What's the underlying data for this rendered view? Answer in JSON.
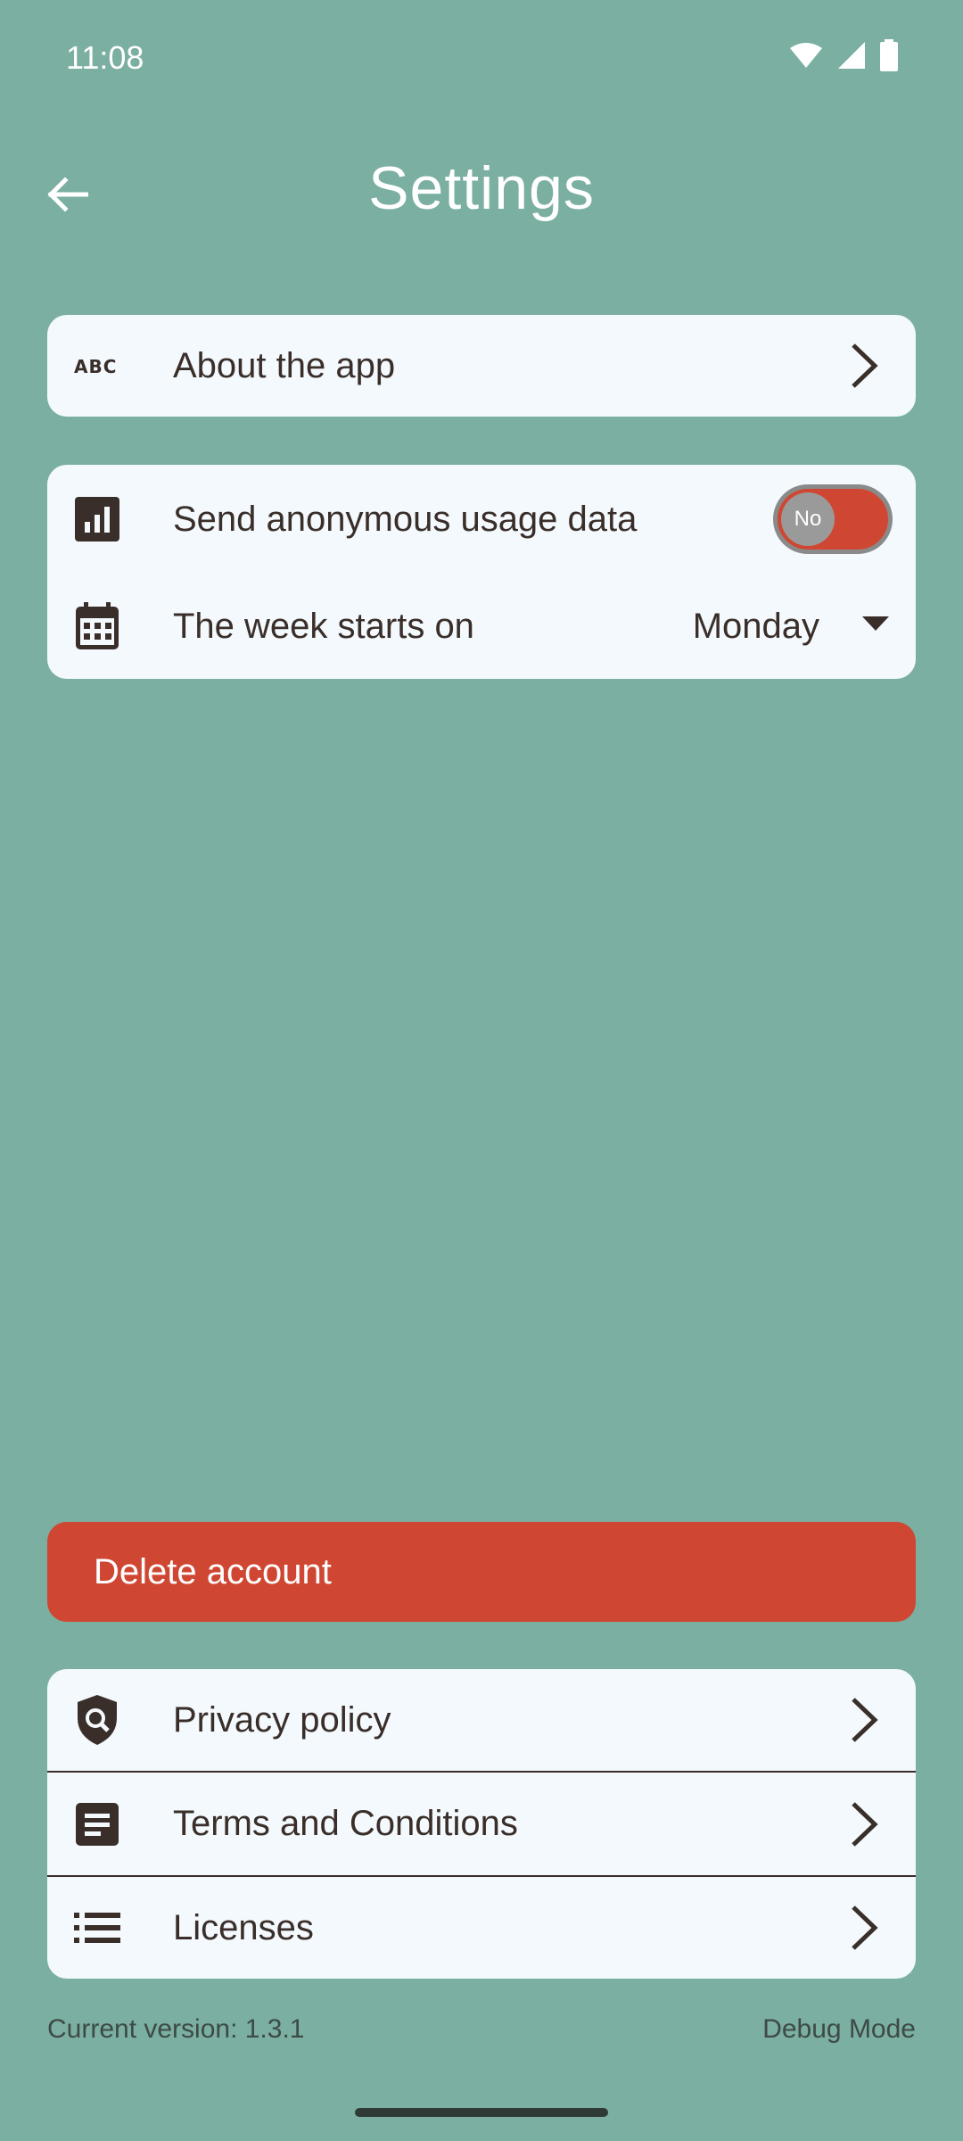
{
  "status_bar": {
    "time": "11:08"
  },
  "app_bar": {
    "title": "Settings",
    "back_icon": "arrow-left-icon"
  },
  "about_card": {
    "label": "About the app",
    "icon": "abc-icon"
  },
  "preferences": {
    "usage": {
      "label": "Send anonymous usage data",
      "icon": "bar-chart-icon",
      "toggle_value": "No",
      "toggle_on": false
    },
    "week_start": {
      "label": "The week starts on",
      "icon": "calendar-icon",
      "selected": "Monday"
    }
  },
  "delete_account": {
    "label": "Delete account",
    "color": "#CF4733"
  },
  "legal": {
    "items": [
      {
        "label": "Privacy policy",
        "icon": "shield-search-icon"
      },
      {
        "label": "Terms and Conditions",
        "icon": "document-icon"
      },
      {
        "label": "Licenses",
        "icon": "list-icon"
      }
    ]
  },
  "footer": {
    "version": "Current version: 1.3.1",
    "debug": "Debug Mode"
  },
  "colors": {
    "background": "#7AAFA1",
    "card": "#F3F9FC",
    "accent": "#CF4733",
    "text": "#3A2E2A"
  }
}
